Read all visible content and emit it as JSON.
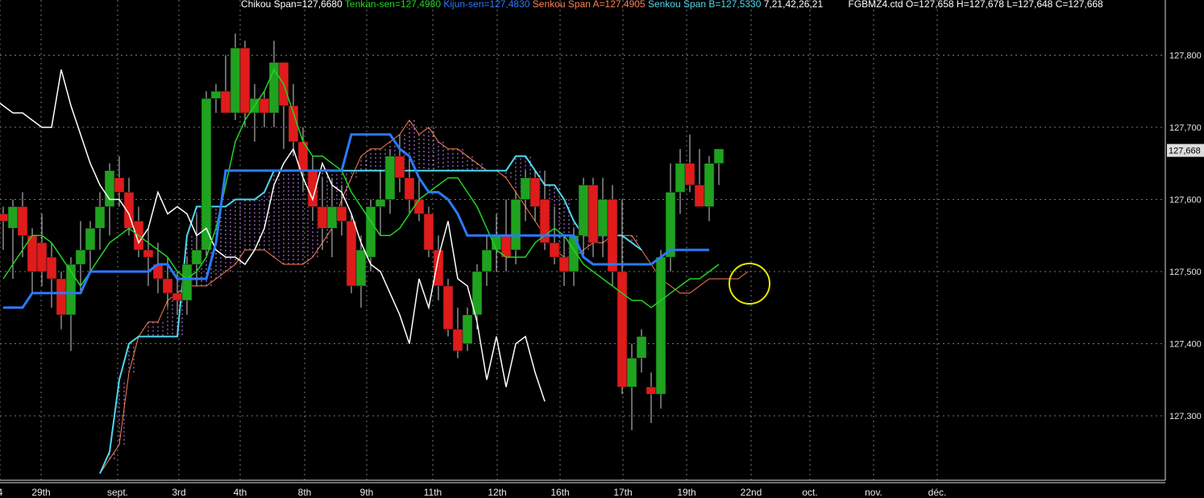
{
  "header": {
    "chikou": "Chikou Span=127,6680",
    "tenkan": "Tenkan-sen=127,4980",
    "kijun": "Kijun-sen=127,4830",
    "senkou_a": "Senkou Span A=127,4905",
    "senkou_b": "Senkou Span B=127,5330",
    "params": " 7,21,42,26,21",
    "ohlc": "FGBMZ4.ctd O=127,658 H=127,678 L=127,648 C=127,668"
  },
  "colors": {
    "background": "#000000",
    "up": "#1fa31f",
    "down": "#e01b1b",
    "chikou": "#ffffff",
    "tenkan": "#22d422",
    "kijun": "#2a7bff",
    "senkou_a": "#ff7f50",
    "senkou_b": "#4fd8f0",
    "cloud": "#cc88ff",
    "grid": "#777777",
    "marker": "#e8e800"
  },
  "chart_data": {
    "type": "candlestick",
    "title": "",
    "ylim": [
      127.23,
      127.88
    ],
    "y_ticks": [
      "127,300",
      "127,400",
      "127,500",
      "127,600",
      "127,700",
      "127,800"
    ],
    "y_tick_values": [
      127.3,
      127.4,
      127.5,
      127.6,
      127.7,
      127.8
    ],
    "last_price_label": "127,668",
    "last_price": 127.668,
    "x_ticks": [
      "4",
      "29th",
      "sept.",
      "3rd",
      "4th",
      "8th",
      "9th",
      "11th",
      "12th",
      "16th",
      "17th",
      "19th",
      "22nd",
      "oct.",
      "nov.",
      "déc."
    ],
    "grid": true,
    "candles": [
      [
        127.58,
        127.59,
        127.53,
        127.57
      ],
      [
        127.56,
        127.6,
        127.49,
        127.59
      ],
      [
        127.59,
        127.61,
        127.52,
        127.55
      ],
      [
        127.55,
        127.56,
        127.47,
        127.5
      ],
      [
        127.54,
        127.58,
        127.48,
        127.5
      ],
      [
        127.52,
        127.54,
        127.45,
        127.49
      ],
      [
        127.49,
        127.5,
        127.42,
        127.44
      ],
      [
        127.44,
        127.52,
        127.39,
        127.51
      ],
      [
        127.51,
        127.57,
        127.47,
        127.53
      ],
      [
        127.53,
        127.57,
        127.5,
        127.56
      ],
      [
        127.56,
        127.61,
        127.53,
        127.59
      ],
      [
        127.59,
        127.65,
        127.55,
        127.64
      ],
      [
        127.63,
        127.66,
        127.59,
        127.61
      ],
      [
        127.61,
        127.63,
        127.55,
        127.56
      ],
      [
        127.57,
        127.59,
        127.52,
        127.53
      ],
      [
        127.53,
        127.56,
        127.48,
        127.52
      ],
      [
        127.51,
        127.54,
        127.47,
        127.49
      ],
      [
        127.49,
        127.52,
        127.45,
        127.47
      ],
      [
        127.47,
        127.5,
        127.44,
        127.46
      ],
      [
        127.46,
        127.52,
        127.44,
        127.51
      ],
      [
        127.51,
        127.58,
        127.48,
        127.53
      ],
      [
        127.53,
        127.75,
        127.52,
        127.74
      ],
      [
        127.74,
        127.76,
        127.72,
        127.75
      ],
      [
        127.75,
        127.8,
        127.73,
        127.72
      ],
      [
        127.72,
        127.83,
        127.71,
        127.81
      ],
      [
        127.81,
        127.82,
        127.7,
        127.72
      ],
      [
        127.72,
        127.76,
        127.68,
        127.74
      ],
      [
        127.74,
        127.75,
        127.7,
        127.72
      ],
      [
        127.72,
        127.82,
        127.7,
        127.79
      ],
      [
        127.79,
        127.79,
        127.67,
        127.73
      ],
      [
        127.73,
        127.76,
        127.66,
        127.68
      ],
      [
        127.68,
        127.7,
        127.61,
        127.64
      ],
      [
        127.64,
        127.66,
        127.57,
        127.59
      ],
      [
        127.59,
        127.63,
        127.53,
        127.56
      ],
      [
        127.56,
        127.63,
        127.52,
        127.59
      ],
      [
        127.59,
        127.62,
        127.55,
        127.57
      ],
      [
        127.57,
        127.58,
        127.47,
        127.48
      ],
      [
        127.48,
        127.55,
        127.45,
        127.53
      ],
      [
        127.52,
        127.6,
        127.5,
        127.59
      ],
      [
        127.59,
        127.64,
        127.55,
        127.6
      ],
      [
        127.6,
        127.67,
        127.58,
        127.66
      ],
      [
        127.66,
        127.69,
        127.61,
        127.63
      ],
      [
        127.63,
        127.66,
        127.58,
        127.6
      ],
      [
        127.6,
        127.63,
        127.57,
        127.58
      ],
      [
        127.58,
        127.59,
        127.52,
        127.53
      ],
      [
        127.53,
        127.55,
        127.46,
        127.48
      ],
      [
        127.48,
        127.49,
        127.41,
        127.42
      ],
      [
        127.42,
        127.45,
        127.38,
        127.39
      ],
      [
        127.4,
        127.45,
        127.39,
        127.44
      ],
      [
        127.44,
        127.51,
        127.42,
        127.5
      ],
      [
        127.5,
        127.55,
        127.48,
        127.53
      ],
      [
        127.53,
        127.58,
        127.5,
        127.55
      ],
      [
        127.55,
        127.6,
        127.5,
        127.52
      ],
      [
        127.53,
        127.61,
        127.51,
        127.6
      ],
      [
        127.6,
        127.64,
        127.57,
        127.63
      ],
      [
        127.63,
        127.64,
        127.57,
        127.59
      ],
      [
        127.6,
        127.64,
        127.53,
        127.54
      ],
      [
        127.54,
        127.59,
        127.51,
        127.52
      ],
      [
        127.52,
        127.55,
        127.48,
        127.5
      ],
      [
        127.5,
        127.56,
        127.48,
        127.55
      ],
      [
        127.55,
        127.63,
        127.52,
        127.62
      ],
      [
        127.62,
        127.63,
        127.52,
        127.54
      ],
      [
        127.55,
        127.63,
        127.52,
        127.6
      ],
      [
        127.6,
        127.62,
        127.48,
        127.5
      ],
      [
        127.5,
        127.6,
        127.33,
        127.34
      ],
      [
        127.34,
        127.4,
        127.28,
        127.38
      ],
      [
        127.38,
        127.42,
        127.36,
        127.41
      ],
      [
        127.34,
        127.36,
        127.29,
        127.33
      ],
      [
        127.33,
        127.53,
        127.31,
        127.52
      ],
      [
        127.52,
        127.65,
        127.5,
        127.61
      ],
      [
        127.61,
        127.67,
        127.58,
        127.65
      ],
      [
        127.65,
        127.69,
        127.61,
        127.62
      ],
      [
        127.62,
        127.67,
        127.59,
        127.59
      ],
      [
        127.59,
        127.66,
        127.57,
        127.65
      ],
      [
        127.65,
        127.67,
        127.62,
        127.67
      ]
    ],
    "series": [
      {
        "name": "Chikou Span",
        "values": [
          127.74,
          127.73,
          127.72,
          127.72,
          127.71,
          127.7,
          127.7,
          127.78,
          127.73,
          127.69,
          127.65,
          127.62,
          127.6,
          127.6,
          127.58,
          127.54,
          127.56,
          127.61,
          127.58,
          127.59,
          127.58,
          127.55,
          127.56,
          127.53,
          127.52,
          127.52,
          127.51,
          127.53,
          127.56,
          127.62,
          127.65,
          127.67,
          127.63,
          127.6,
          127.65,
          127.62,
          127.61,
          127.58,
          127.54,
          127.51,
          127.5,
          127.47,
          127.44,
          127.4,
          127.49,
          127.45,
          127.52,
          127.57,
          127.49,
          127.48,
          127.43,
          127.35,
          127.41,
          127.34,
          127.4,
          127.41,
          127.36,
          127.32
        ]
      },
      {
        "name": "Tenkan-sen",
        "values": [
          127.49,
          127.51,
          127.53,
          127.55,
          127.55,
          127.54,
          127.52,
          127.5,
          127.48,
          127.5,
          127.52,
          127.54,
          127.55,
          127.56,
          127.55,
          127.54,
          127.53,
          127.52,
          127.5,
          127.49,
          127.5,
          127.52,
          127.56,
          127.62,
          127.68,
          127.71,
          127.73,
          127.75,
          127.78,
          127.76,
          127.72,
          127.68,
          127.66,
          127.66,
          127.65,
          127.64,
          127.61,
          127.59,
          127.57,
          127.55,
          127.55,
          127.56,
          127.58,
          127.6,
          127.61,
          127.62,
          127.63,
          127.63,
          127.61,
          127.59,
          127.56,
          127.53,
          127.52,
          127.52,
          127.52,
          127.54,
          127.55,
          127.56,
          127.55,
          127.53,
          127.51,
          127.5,
          127.49,
          127.48,
          127.47,
          127.46,
          127.46,
          127.45,
          127.46,
          127.47,
          127.48,
          127.49,
          127.49,
          127.5,
          127.51
        ]
      },
      {
        "name": "Kijun-sen",
        "values": [
          127.45,
          127.45,
          127.45,
          127.47,
          127.47,
          127.47,
          127.47,
          127.47,
          127.47,
          127.5,
          127.5,
          127.5,
          127.5,
          127.5,
          127.5,
          127.5,
          127.51,
          127.51,
          127.49,
          127.49,
          127.49,
          127.49,
          127.54,
          127.64,
          127.64,
          127.64,
          127.64,
          127.64,
          127.64,
          127.64,
          127.64,
          127.64,
          127.64,
          127.64,
          127.64,
          127.64,
          127.69,
          127.69,
          127.69,
          127.69,
          127.69,
          127.67,
          127.66,
          127.63,
          127.61,
          127.61,
          127.6,
          127.58,
          127.55,
          127.55,
          127.55,
          127.55,
          127.55,
          127.55,
          127.55,
          127.55,
          127.55,
          127.55,
          127.55,
          127.55,
          127.52,
          127.51,
          127.51,
          127.51,
          127.51,
          127.51,
          127.51,
          127.51,
          127.52,
          127.53,
          127.53,
          127.53,
          127.53,
          127.53
        ]
      },
      {
        "name": "Senkou Span A",
        "values": [
          127.22,
          127.24,
          127.26,
          127.36,
          127.41,
          127.43,
          127.43,
          127.46,
          127.47,
          127.48,
          127.48,
          127.48,
          127.49,
          127.5,
          127.51,
          127.53,
          127.53,
          127.53,
          127.52,
          127.51,
          127.51,
          127.51,
          127.52,
          127.54,
          127.56,
          127.6,
          127.63,
          127.66,
          127.67,
          127.67,
          127.68,
          127.69,
          127.71,
          127.69,
          127.7,
          127.68,
          127.67,
          127.67,
          127.66,
          127.65,
          127.64,
          127.64,
          127.63,
          127.61,
          127.59,
          127.57,
          127.55,
          127.53,
          127.52,
          127.52,
          127.53,
          127.54,
          127.54,
          127.55,
          127.55,
          127.55,
          127.53,
          127.51,
          127.49,
          127.48,
          127.47,
          127.47,
          127.48,
          127.49,
          127.49,
          127.49,
          127.49,
          127.5
        ]
      },
      {
        "name": "Senkou Span B",
        "values": [
          127.22,
          127.25,
          127.35,
          127.4,
          127.41,
          127.41,
          127.41,
          127.41,
          127.41,
          127.55,
          127.59,
          127.59,
          127.59,
          127.59,
          127.6,
          127.6,
          127.6,
          127.61,
          127.64,
          127.64,
          127.64,
          127.64,
          127.64,
          127.64,
          127.64,
          127.64,
          127.64,
          127.64,
          127.64,
          127.64,
          127.64,
          127.64,
          127.64,
          127.64,
          127.64,
          127.64,
          127.64,
          127.64,
          127.64,
          127.64,
          127.64,
          127.64,
          127.64,
          127.66,
          127.66,
          127.64,
          127.62,
          127.62,
          127.6,
          127.57,
          127.55,
          127.55,
          127.55,
          127.55,
          127.55,
          127.54,
          127.53
        ]
      }
    ]
  }
}
